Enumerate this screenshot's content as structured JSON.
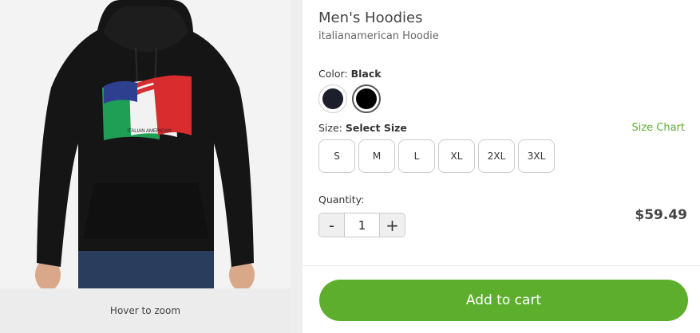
{
  "gallery": {
    "zoom_hint": "Hover to zoom",
    "flag_text": "ITALIAN AMERICAN"
  },
  "product": {
    "title": "Men's Hoodies",
    "subtitle": "italianamerican Hoodie"
  },
  "color": {
    "label": "Color:",
    "selected": "Black",
    "swatches": [
      {
        "name": "Navy",
        "hex": "#1c1e2c"
      },
      {
        "name": "Black",
        "hex": "#000000"
      }
    ]
  },
  "size": {
    "label": "Size:",
    "selected": "Select Size",
    "chart_link": "Size Chart",
    "options": [
      "S",
      "M",
      "L",
      "XL",
      "2XL",
      "3XL"
    ]
  },
  "quantity": {
    "label": "Quantity:",
    "minus": "-",
    "value": "1",
    "plus": "+"
  },
  "price": "$59.49",
  "cart_button": "Add to cart",
  "colors": {
    "accent": "#5eae2e",
    "hoodie": "#151515"
  }
}
